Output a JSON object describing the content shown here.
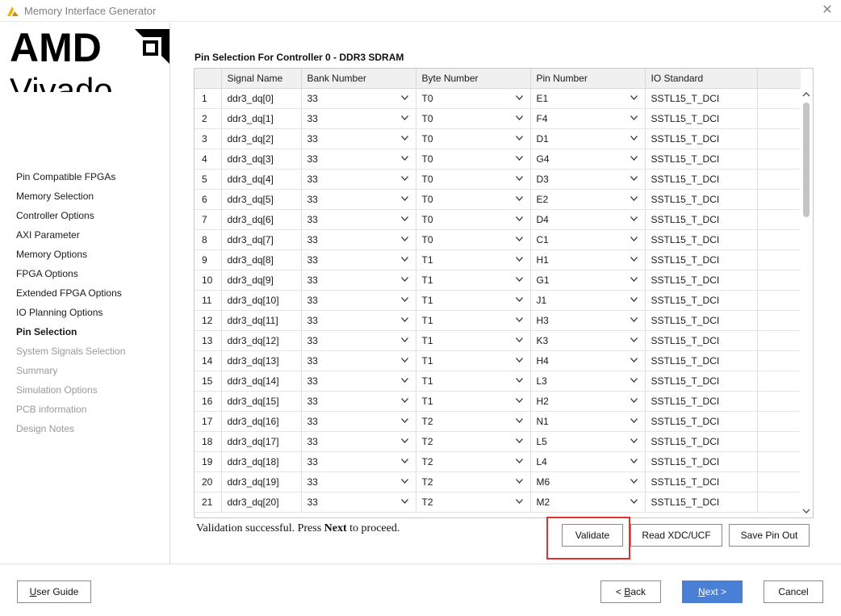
{
  "window": {
    "title": "Memory Interface Generator"
  },
  "brand": {
    "company": "AMD",
    "product": "Vivado"
  },
  "nav": {
    "items": [
      {
        "label": "Pin Compatible FPGAs",
        "state": "normal"
      },
      {
        "label": "Memory Selection",
        "state": "normal"
      },
      {
        "label": "Controller Options",
        "state": "normal"
      },
      {
        "label": "AXI Parameter",
        "state": "normal"
      },
      {
        "label": "Memory Options",
        "state": "normal"
      },
      {
        "label": "FPGA Options",
        "state": "normal"
      },
      {
        "label": "Extended FPGA Options",
        "state": "normal"
      },
      {
        "label": "IO Planning Options",
        "state": "normal"
      },
      {
        "label": "Pin Selection",
        "state": "active"
      },
      {
        "label": "System Signals Selection",
        "state": "disabled"
      },
      {
        "label": "Summary",
        "state": "disabled"
      },
      {
        "label": "Simulation Options",
        "state": "disabled"
      },
      {
        "label": "PCB information",
        "state": "disabled"
      },
      {
        "label": "Design Notes",
        "state": "disabled"
      }
    ]
  },
  "main": {
    "section_title": "Pin Selection For Controller 0 - DDR3 SDRAM",
    "table": {
      "headers": [
        "",
        "Signal Name",
        "Bank Number",
        "Byte Number",
        "Pin Number",
        "IO Standard"
      ],
      "rows": [
        {
          "num": "1",
          "signal": "ddr3_dq[0]",
          "bank": "33",
          "byte": "T0",
          "pin": "E1",
          "io": "SSTL15_T_DCI"
        },
        {
          "num": "2",
          "signal": "ddr3_dq[1]",
          "bank": "33",
          "byte": "T0",
          "pin": "F4",
          "io": "SSTL15_T_DCI"
        },
        {
          "num": "3",
          "signal": "ddr3_dq[2]",
          "bank": "33",
          "byte": "T0",
          "pin": "D1",
          "io": "SSTL15_T_DCI"
        },
        {
          "num": "4",
          "signal": "ddr3_dq[3]",
          "bank": "33",
          "byte": "T0",
          "pin": "G4",
          "io": "SSTL15_T_DCI"
        },
        {
          "num": "5",
          "signal": "ddr3_dq[4]",
          "bank": "33",
          "byte": "T0",
          "pin": "D3",
          "io": "SSTL15_T_DCI"
        },
        {
          "num": "6",
          "signal": "ddr3_dq[5]",
          "bank": "33",
          "byte": "T0",
          "pin": "E2",
          "io": "SSTL15_T_DCI"
        },
        {
          "num": "7",
          "signal": "ddr3_dq[6]",
          "bank": "33",
          "byte": "T0",
          "pin": "D4",
          "io": "SSTL15_T_DCI"
        },
        {
          "num": "8",
          "signal": "ddr3_dq[7]",
          "bank": "33",
          "byte": "T0",
          "pin": "C1",
          "io": "SSTL15_T_DCI"
        },
        {
          "num": "9",
          "signal": "ddr3_dq[8]",
          "bank": "33",
          "byte": "T1",
          "pin": "H1",
          "io": "SSTL15_T_DCI"
        },
        {
          "num": "10",
          "signal": "ddr3_dq[9]",
          "bank": "33",
          "byte": "T1",
          "pin": "G1",
          "io": "SSTL15_T_DCI"
        },
        {
          "num": "11",
          "signal": "ddr3_dq[10]",
          "bank": "33",
          "byte": "T1",
          "pin": "J1",
          "io": "SSTL15_T_DCI"
        },
        {
          "num": "12",
          "signal": "ddr3_dq[11]",
          "bank": "33",
          "byte": "T1",
          "pin": "H3",
          "io": "SSTL15_T_DCI"
        },
        {
          "num": "13",
          "signal": "ddr3_dq[12]",
          "bank": "33",
          "byte": "T1",
          "pin": "K3",
          "io": "SSTL15_T_DCI"
        },
        {
          "num": "14",
          "signal": "ddr3_dq[13]",
          "bank": "33",
          "byte": "T1",
          "pin": "H4",
          "io": "SSTL15_T_DCI"
        },
        {
          "num": "15",
          "signal": "ddr3_dq[14]",
          "bank": "33",
          "byte": "T1",
          "pin": "L3",
          "io": "SSTL15_T_DCI"
        },
        {
          "num": "16",
          "signal": "ddr3_dq[15]",
          "bank": "33",
          "byte": "T1",
          "pin": "H2",
          "io": "SSTL15_T_DCI"
        },
        {
          "num": "17",
          "signal": "ddr3_dq[16]",
          "bank": "33",
          "byte": "T2",
          "pin": "N1",
          "io": "SSTL15_T_DCI"
        },
        {
          "num": "18",
          "signal": "ddr3_dq[17]",
          "bank": "33",
          "byte": "T2",
          "pin": "L5",
          "io": "SSTL15_T_DCI"
        },
        {
          "num": "19",
          "signal": "ddr3_dq[18]",
          "bank": "33",
          "byte": "T2",
          "pin": "L4",
          "io": "SSTL15_T_DCI"
        },
        {
          "num": "20",
          "signal": "ddr3_dq[19]",
          "bank": "33",
          "byte": "T2",
          "pin": "M6",
          "io": "SSTL15_T_DCI"
        },
        {
          "num": "21",
          "signal": "ddr3_dq[20]",
          "bank": "33",
          "byte": "T2",
          "pin": "M2",
          "io": "SSTL15_T_DCI"
        }
      ]
    },
    "status": {
      "prefix": "Validation successful. Press ",
      "emphasis": "Next",
      "suffix": " to proceed."
    },
    "buttons": {
      "validate": "Validate",
      "read_xdc": "Read XDC/UCF",
      "save_pin_out": "Save Pin Out"
    }
  },
  "footer": {
    "user_guide_mnemonic": "U",
    "user_guide_rest": "ser Guide",
    "back_prefix": "< ",
    "back_mnemonic": "B",
    "back_rest": "ack",
    "next_mnemonic": "N",
    "next_rest": "ext >",
    "cancel": "Cancel"
  },
  "colors": {
    "accent": "#4a7fd6",
    "highlight": "#e03030",
    "disabled_text": "#9a9a9a",
    "amd_logo": "#000000",
    "title_logo": "#f0b400"
  }
}
